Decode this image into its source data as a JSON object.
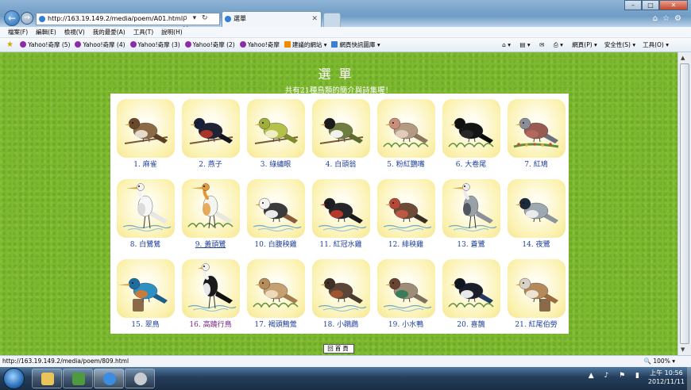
{
  "browser": {
    "url": "http://163.19.149.2/media/poem/A01.html",
    "address_tools": "ρ ▾ ↻ ✕",
    "tab_title": "選單",
    "menu": [
      "檔案(F)",
      "編輯(E)",
      "檢視(V)",
      "我的最愛(A)",
      "工具(T)",
      "說明(H)"
    ],
    "favorites": [
      {
        "label": "Yahoo!奇摩 (5)",
        "icon": "yahoo-icon"
      },
      {
        "label": "Yahoo!奇摩 (4)",
        "icon": "yahoo-icon"
      },
      {
        "label": "Yahoo!奇摩 (3)",
        "icon": "yahoo-icon"
      },
      {
        "label": "Yahoo!奇摩 (2)",
        "icon": "yahoo-icon"
      },
      {
        "label": "Yahoo!奇摩",
        "icon": "yahoo-icon"
      },
      {
        "label": "建議的網站 ▾",
        "icon": "suggested-sites-icon"
      },
      {
        "label": "網頁快訊圖庫 ▾",
        "icon": "web-slice-icon"
      }
    ],
    "command_bar": [
      "網頁(P) ▾",
      "安全性(S) ▾",
      "工具(O) ▾"
    ],
    "status_url": "http://163.19.149.2/media/poem/809.html",
    "zoom": "100%"
  },
  "page": {
    "title": "選單",
    "subtitle": "共有21種鳥類的簡介與詩集喔！",
    "home_button": "回首頁",
    "birds": [
      {
        "label": "1. 麻雀",
        "body": "#8a6b45",
        "head": "#6b4a2b",
        "accent": "#f0e8d8",
        "tail": "#5a4126",
        "perch": "branch"
      },
      {
        "label": "2. 燕子",
        "body": "#1f2333",
        "head": "#17203a",
        "accent": "#b8372c",
        "tail": "#12141d",
        "perch": "branch"
      },
      {
        "label": "3. 綠繡眼",
        "body": "#b5c04a",
        "head": "#9fb03a",
        "accent": "#f4f2d0",
        "tail": "#7e8c2c",
        "perch": "branch"
      },
      {
        "label": "4. 白頭翁",
        "body": "#6f7d3e",
        "head": "#1b1b1b",
        "accent": "#ffffff",
        "tail": "#5d6b2f",
        "perch": "branch"
      },
      {
        "label": "5. 粉紅鸚嘴",
        "body": "#b49a80",
        "head": "#c98d7c",
        "accent": "#e6d2c0",
        "tail": "#8d7560",
        "perch": "grass"
      },
      {
        "label": "6. 大卷尾",
        "body": "#141414",
        "head": "#101010",
        "accent": "#2a2a2a",
        "tail": "#0b0b0b",
        "perch": "grass"
      },
      {
        "label": "7. 紅鳩",
        "body": "#9a5a54",
        "head": "#8c8f9a",
        "accent": "#b46a5f",
        "tail": "#6d6f7a",
        "perch": "flowers"
      },
      {
        "label": "8. 白鷺鷥",
        "body": "#f7f7f7",
        "head": "#f2f2f2",
        "accent": "#d8d8d8",
        "tail": "#e6e6e6",
        "perch": "water"
      },
      {
        "label": "9. 黃頭鷺",
        "body": "#f5f5f0",
        "head": "#e39a36",
        "accent": "#e5a348",
        "tail": "#e8e8e0",
        "perch": "grass"
      },
      {
        "label": "10. 白腹秧雞",
        "body": "#3b3b3b",
        "head": "#f2f2f2",
        "accent": "#ffffff",
        "tail": "#8a5a3b",
        "perch": "water"
      },
      {
        "label": "11. 紅冠水雞",
        "body": "#25262a",
        "head": "#1d1d22",
        "accent": "#c63a2b",
        "tail": "#1a1a1a",
        "perch": "water"
      },
      {
        "label": "12. 緋秧雞",
        "body": "#6d4b36",
        "head": "#b8493a",
        "accent": "#c45a45",
        "tail": "#3e2d22",
        "perch": "water"
      },
      {
        "label": "13. 蒼鷺",
        "body": "#9aa0a8",
        "head": "#e9ebee",
        "accent": "#4a4f57",
        "tail": "#8c9199",
        "perch": "water"
      },
      {
        "label": "14. 夜鷺",
        "body": "#9ea8b0",
        "head": "#1c2a3a",
        "accent": "#f2f2f2",
        "tail": "#8b959c",
        "perch": "none"
      },
      {
        "label": "15. 翠鳥",
        "body": "#2e8fc2",
        "head": "#1f6d9e",
        "accent": "#d77a2e",
        "tail": "#1e5f8a",
        "perch": "stump"
      },
      {
        "label": "16. 高蹺行鳥",
        "body": "#1a1a1a",
        "head": "#f2f2f2",
        "accent": "#ffffff",
        "tail": "#111111",
        "perch": "water"
      },
      {
        "label": "17. 褐頭鷦鶯",
        "body": "#c6a070",
        "head": "#b58d5c",
        "accent": "#efe0c2",
        "tail": "#a37d4f",
        "perch": "grass"
      },
      {
        "label": "18. 小鸊鷉",
        "body": "#5b4536",
        "head": "#3f2f24",
        "accent": "#a6542f",
        "tail": "#4a3a2e",
        "perch": "water"
      },
      {
        "label": "19. 小水鴨",
        "body": "#9c8c78",
        "head": "#6a4432",
        "accent": "#2f7a55",
        "tail": "#7f705f",
        "perch": "water"
      },
      {
        "label": "20. 喜鵲",
        "body": "#1a1f2b",
        "head": "#111522",
        "accent": "#ffffff",
        "tail": "#223b5e",
        "perch": "grass"
      },
      {
        "label": "21. 紅尾伯勞",
        "body": "#b58a5b",
        "head": "#d8d2c6",
        "accent": "#f4ede0",
        "tail": "#9a6b3e",
        "perch": "stump"
      }
    ],
    "visited_index": 15,
    "hover_index": 8
  },
  "taskbar": {
    "clock_time": "上午 10:56",
    "clock_date": "2012/11/11"
  }
}
